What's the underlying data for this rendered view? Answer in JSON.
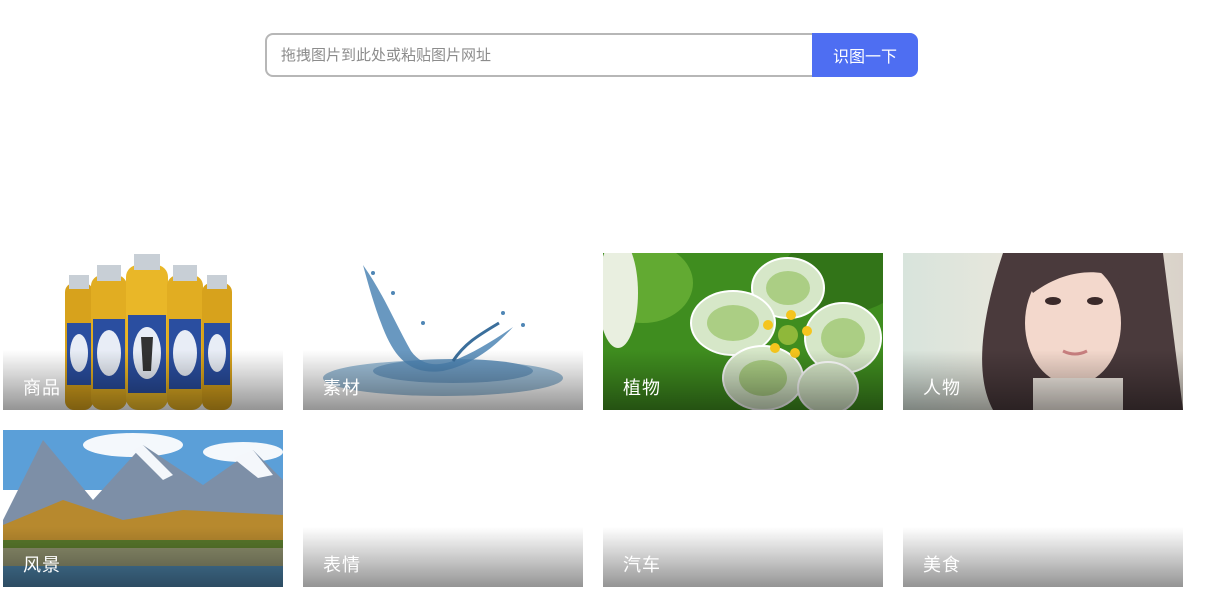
{
  "search": {
    "placeholder": "拖拽图片到此处或粘贴图片网址",
    "value": "",
    "button_label": "识图一下"
  },
  "categories": [
    {
      "label": "商品"
    },
    {
      "label": "素材"
    },
    {
      "label": "植物"
    },
    {
      "label": "人物"
    },
    {
      "label": "风景"
    },
    {
      "label": "表情"
    },
    {
      "label": "汽车"
    },
    {
      "label": "美食"
    }
  ],
  "colors": {
    "accent": "#4e6ef2",
    "input_border": "#b7b7b7",
    "label_text": "#ffffff"
  }
}
